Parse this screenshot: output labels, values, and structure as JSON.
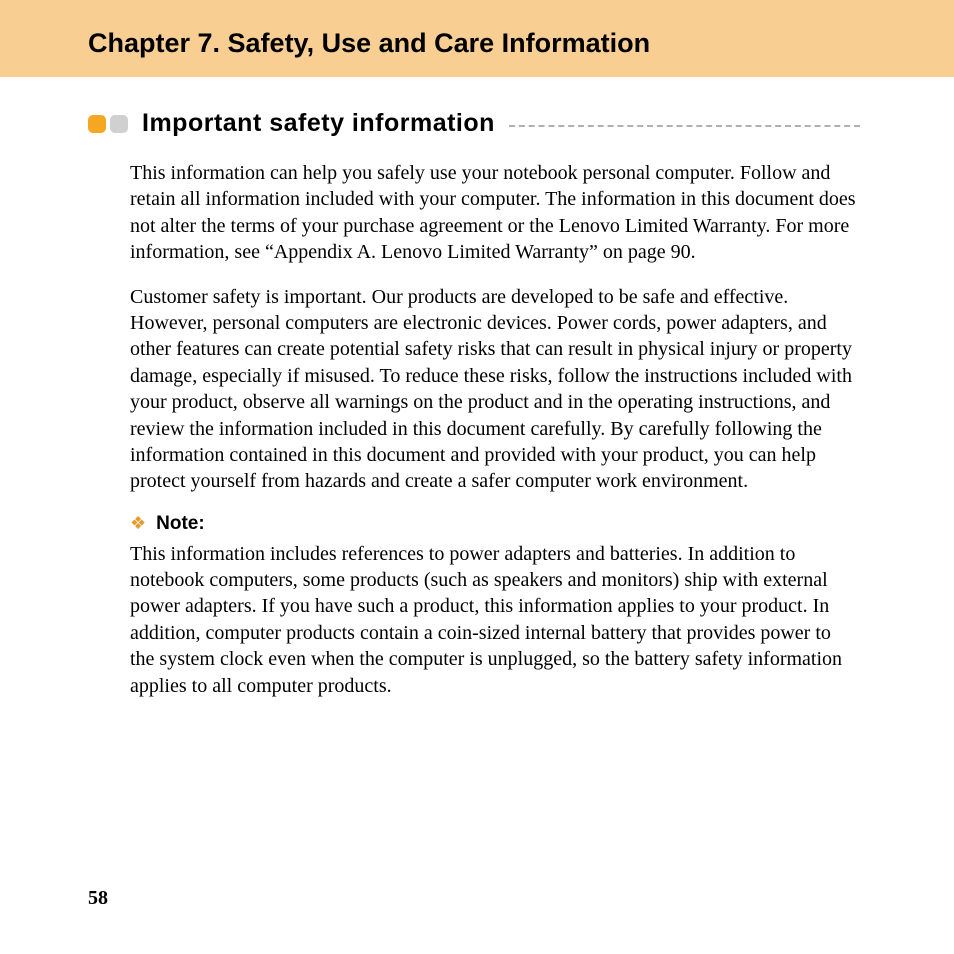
{
  "header": {
    "chapter_title": "Chapter 7. Safety, Use and Care Information"
  },
  "section": {
    "title": "Important safety information",
    "paragraph1": "This information can help you safely use your notebook personal computer. Follow and retain all information included with your computer. The information in this document does not alter the terms of your purchase agreement or the Lenovo Limited Warranty. For more information, see “Appendix A. Lenovo Limited Warranty” on page 90.",
    "paragraph2": "Customer safety is important. Our products are developed to be safe and effective. However, personal computers are electronic devices. Power cords, power adapters, and other features can create potential safety risks that can result in physical injury or property damage, especially if misused. To reduce these risks, follow the instructions included with your product, observe all warnings on the product and in the operating instructions, and review the information included in this document carefully. By carefully following the information contained in this document and provided with your product, you can help protect yourself from hazards and create a safer computer work environment.",
    "note_label": "Note:",
    "note_text": "This information includes references to power adapters and batteries. In addition to notebook computers, some products (such as speakers and monitors) ship with external power adapters. If you have such a product, this information applies to your product. In addition, computer products contain a coin-sized internal battery that provides power to the system clock even when the computer is unplugged, so the battery safety information applies to all computer products."
  },
  "page_number": "58"
}
